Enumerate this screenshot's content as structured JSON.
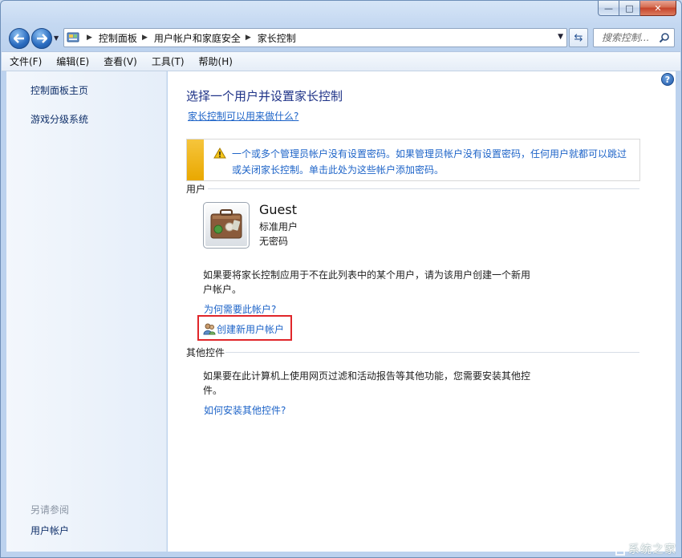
{
  "window": {
    "caption_min": "—",
    "caption_max": "□",
    "caption_close": "✕"
  },
  "nav": {
    "breadcrumbs": [
      "控制面板",
      "用户帐户和家庭安全",
      "家长控制"
    ],
    "search_placeholder": "搜索控制...",
    "icons": [
      "back-arrow-icon",
      "forward-arrow-icon",
      "control-panel-icon",
      "refresh-icon",
      "search-icon"
    ]
  },
  "menu": [
    "文件(F)",
    "编辑(E)",
    "查看(V)",
    "工具(T)",
    "帮助(H)"
  ],
  "sidebar": {
    "links": [
      "控制面板主页",
      "游戏分级系统"
    ],
    "see_also_header": "另请参阅",
    "see_also_links": [
      "用户帐户"
    ]
  },
  "main": {
    "title": "选择一个用户并设置家长控制",
    "what_link": "家长控制可以用来做什么?",
    "warning": "一个或多个管理员帐户没有设置密码。如果管理员帐户没有设置密码，任何用户就都可以跳过或关闭家长控制。单击此处为这些帐户添加密码。",
    "users_section": "用户",
    "user": {
      "name": "Guest",
      "type": "标准用户",
      "password": "无密码"
    },
    "create_info": "如果要将家长控制应用于不在此列表中的某个用户，请为该用户创建一个新用户帐户。",
    "why_link": "为何需要此帐户?",
    "create_link": "创建新用户帐户",
    "other_section": "其他控件",
    "other_info": "如果要在此计算机上使用网页过滤和活动报告等其他功能，您需要安装其他控件。",
    "install_link": "如何安装其他控件?"
  },
  "watermark": "系统之家",
  "colors": {
    "link": "#1e64c8",
    "title": "#1e3287",
    "warning_bar": "#f0b81a",
    "highlight": "#e0262a"
  }
}
